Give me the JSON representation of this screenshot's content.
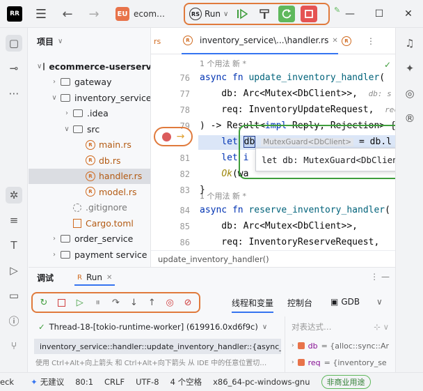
{
  "titlebar": {
    "logo_text": "RR",
    "project_badge": "EU",
    "project_name": "ecom…",
    "run_config_label": "Run",
    "run_config_badge": "RS"
  },
  "project_panel": {
    "title": "项目",
    "tree": [
      {
        "label": "ecommerce-userservices",
        "depth": 0,
        "kind": "folder",
        "expanded": true
      },
      {
        "label": "gateway",
        "depth": 1,
        "kind": "folder",
        "expanded": false
      },
      {
        "label": "inventory_service",
        "depth": 1,
        "kind": "folder",
        "expanded": true
      },
      {
        "label": ".idea",
        "depth": 2,
        "kind": "folder",
        "expanded": false
      },
      {
        "label": "src",
        "depth": 2,
        "kind": "folder",
        "expanded": true
      },
      {
        "label": "main.rs",
        "depth": 3,
        "kind": "rs"
      },
      {
        "label": "db.rs",
        "depth": 3,
        "kind": "rs"
      },
      {
        "label": "handler.rs",
        "depth": 3,
        "kind": "rs",
        "selected": true
      },
      {
        "label": "model.rs",
        "depth": 3,
        "kind": "rs"
      },
      {
        "label": ".gitignore",
        "depth": 2,
        "kind": "gitignore"
      },
      {
        "label": "Cargo.toml",
        "depth": 2,
        "kind": "toml"
      },
      {
        "label": "order_service",
        "depth": 1,
        "kind": "folder",
        "expanded": false
      },
      {
        "label": "payment service",
        "depth": 1,
        "kind": "folder",
        "expanded": false
      }
    ]
  },
  "editor": {
    "tab_left": "rs",
    "tab_active": "inventory_service\\...\\handler.rs",
    "hint1": "1 个用法   新 *",
    "hint2": "1 个用法   新 *",
    "line_numbers": [
      "76",
      "77",
      "78",
      "79",
      "80",
      "81",
      "82",
      "83",
      "84",
      "85",
      "86"
    ],
    "code": {
      "l76a": "async fn ",
      "l76b": "update_inventory_handler",
      "l76c": "(",
      "l77": "    db: Arc<Mutex<DbClient>>,",
      "l77hint": "db: s",
      "l78": "    req: InventoryUpdateRequest,",
      "l78hint": "rec",
      "l79a": ") -> Result<",
      "l79b": "impl",
      "l79c": " Reply, Rejection> {",
      "l80a": "    let ",
      "l80b": "db",
      "l80hint": "MutexGuard<DbClient>",
      "l80c": " = db.l",
      "l81": "    let i",
      "l82a": "    ",
      "l82b": "Ok",
      "l82c": "(wa",
      "l83": "}",
      "l84a": "async fn ",
      "l84b": "reserve_inventory_handler",
      "l84c": "(",
      "l85": "    db: Arc<Mutex<DbClient>>,",
      "l86": "    req: InventoryReserveRequest,"
    },
    "popup": "let db: MutexGuard<DbClient>",
    "breadcrumb": "update_inventory_handler()"
  },
  "debug": {
    "tab_debug": "调试",
    "tab_run": "Run",
    "tab_threads": "线程和变量",
    "tab_console": "控制台",
    "tab_gdb": "GDB",
    "thread": "Thread-18-[tokio-runtime-worker] (619916.0xd6f9c)",
    "frame": "inventory_service::handler::update_inventory_handler::{async_fn#",
    "eval_placeholder": "对表达式…",
    "vars": [
      {
        "name": "db",
        "value": "= {alloc::sync::Ar"
      },
      {
        "name": "req",
        "value": "= {inventory_se"
      }
    ],
    "hint_text": "使用 Ctrl+Alt+向上箭头 和 Ctrl+Alt+向下箭头 从 IDE 中的任意位置切…"
  },
  "statusbar": {
    "left_clip": "eck",
    "no_suggestions": "无建议",
    "position": "80:1",
    "line_sep": "CRLF",
    "encoding": "UTF-8",
    "indent": "4 个空格",
    "target": "x86_64-pc-windows-gnu",
    "license": "非商业用途"
  }
}
